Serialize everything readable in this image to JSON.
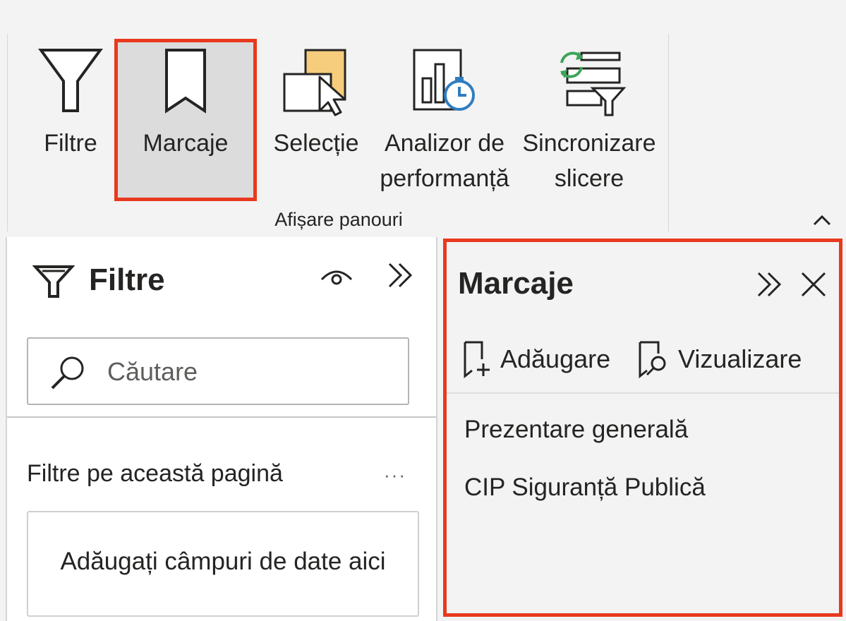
{
  "ribbon": {
    "buttons": [
      {
        "label": "Filtre",
        "icon": "filter-icon",
        "active": false
      },
      {
        "label": "Marcaje",
        "icon": "bookmark-icon",
        "active": true
      },
      {
        "label": "Selecție",
        "icon": "selection-icon",
        "active": false
      },
      {
        "label": "Analizor de\nperformanță",
        "icon": "performance-analyzer-icon",
        "active": false
      },
      {
        "label": "Sincronizare\nslicere",
        "icon": "sync-slicers-icon",
        "active": false
      }
    ],
    "group_label": "Afișare panouri"
  },
  "filters_pane": {
    "title": "Filtre",
    "search_placeholder": "Căutare",
    "section_title": "Filtre pe această pagină",
    "more_label": "···",
    "drop_zone_text": "Adăugați câmpuri de date aici"
  },
  "bookmarks_pane": {
    "title": "Marcaje",
    "add_label": "Adăugare",
    "view_label": "Vizualizare",
    "items": [
      "Prezentare generală",
      "CIP Siguranță Publică"
    ]
  },
  "colors": {
    "highlight": "#e8391f",
    "ribbon_bg": "#f3f3f3",
    "active_bg": "#dcdcdc",
    "text": "#252423"
  }
}
